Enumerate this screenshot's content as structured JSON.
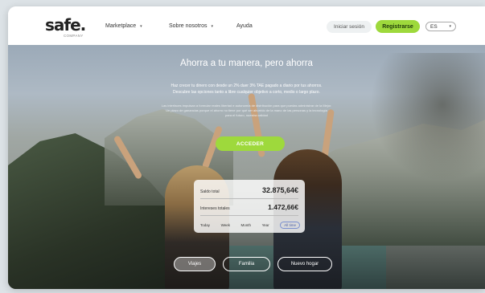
{
  "nav": {
    "logo_main": "safe.",
    "logo_sub": "COMPANY",
    "items": [
      {
        "label": "Marketplace",
        "has_dropdown": true
      },
      {
        "label": "Sobre nosotros",
        "has_dropdown": true
      },
      {
        "label": "Ayuda",
        "has_dropdown": false
      }
    ],
    "login_label": "Iniciar sesión",
    "register_label": "Registrarse",
    "language": "ES"
  },
  "hero": {
    "title": "Ahorra a tu manera, pero ahorra",
    "subtitle_line1": "Haz crecer tu dinero con desde un 2% duer 3% TAE pagado a diario por tus ahorros.",
    "subtitle_line2": "Descubre las opciones tanto a libre cualquier objetivo a corto, medio o largo plazo.",
    "small_text_1": "Las interfaces impulsan a formular reales libertad e autonomía de distribución para que puedas administrar de la Mejor.",
    "small_text_2": "Un plazo de ganancias porque el ahorro no tiene por qué ser aburrido de la mano de las personas y la tecnología",
    "small_text_3": "para el futuro, nuestra calidad",
    "cta_label": "ACCEDER"
  },
  "summary_card": {
    "total_label": "Saldo total",
    "total_value": "32.875,64€",
    "interest_label": "Intereses totales",
    "interest_value": "1.472,66€",
    "periods": [
      "Today",
      "Week",
      "Month",
      "Year",
      "All time"
    ],
    "active_period": "All time"
  },
  "goals": [
    {
      "label": "Viajes",
      "active": true
    },
    {
      "label": "Familia",
      "active": false
    },
    {
      "label": "Nuevo hogar",
      "active": false
    }
  ],
  "colors": {
    "accent": "#9ed93c",
    "period_active": "#4a5fa8"
  }
}
